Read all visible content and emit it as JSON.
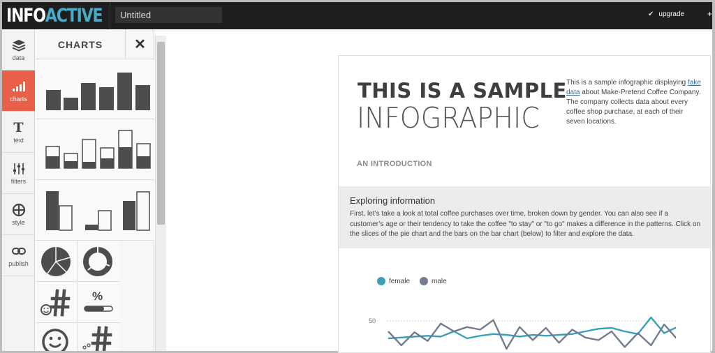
{
  "app": {
    "logo_part1": "INFO",
    "logo_part2": "ACTIVE",
    "doc_title": "Untitled",
    "upgrade_label": "upgrade",
    "plus": "+"
  },
  "rail": [
    {
      "label": "data",
      "icon": "layers-icon"
    },
    {
      "label": "charts",
      "icon": "bar-chart-icon",
      "active": true
    },
    {
      "label": "text",
      "icon": "text-icon",
      "glyph": "T"
    },
    {
      "label": "filters",
      "icon": "sliders-icon"
    },
    {
      "label": "style",
      "icon": "style-icon"
    },
    {
      "label": "publish",
      "icon": "link-icon"
    }
  ],
  "panel": {
    "title": "CHARTS",
    "close": "✕",
    "number_hash": "#",
    "number_percent": "%"
  },
  "infographic": {
    "title_line1": "THIS IS A SAMPLE",
    "title_line2": "INFOGRAPHIC",
    "intro_before": "This is a sample infographic displaying ",
    "intro_link": "fake data",
    "intro_after": " about Make-Pretend Coffee Company. The company collects data about every coffee shop purchase, at each of their seven locations.",
    "subhead": "AN INTRODUCTION",
    "section_title": "Exploring information",
    "section_body": "First, let’s take a look at total coffee purchases over time, broken down by gender. You can also see if a customer’s age or their tendency to take the coffee \"to stay\" or \"to go\" makes a difference in the patterns. Click on the slices of the pie chart and the bars on the bar chart (below) to filter and explore the data."
  },
  "colors": {
    "accent": "#e8604a",
    "female": "#3aa0b8",
    "male": "#737b91",
    "logo_blue": "#4aa9c6"
  },
  "chart_data": {
    "type": "line",
    "legend_placement": "top-left",
    "y_tick_label": "50",
    "y_tick_value": 50,
    "series": [
      {
        "name": "female",
        "values": [
          30,
          31,
          32,
          33,
          32,
          38,
          30,
          33,
          35,
          34,
          32,
          34,
          33,
          34,
          35,
          38,
          41,
          42,
          38,
          35,
          54,
          36,
          43
        ]
      },
      {
        "name": "male",
        "values": [
          38,
          22,
          37,
          27,
          47,
          38,
          43,
          40,
          51,
          18,
          43,
          28,
          42,
          25,
          40,
          31,
          28,
          38,
          20,
          36,
          22,
          46,
          29
        ]
      }
    ]
  }
}
